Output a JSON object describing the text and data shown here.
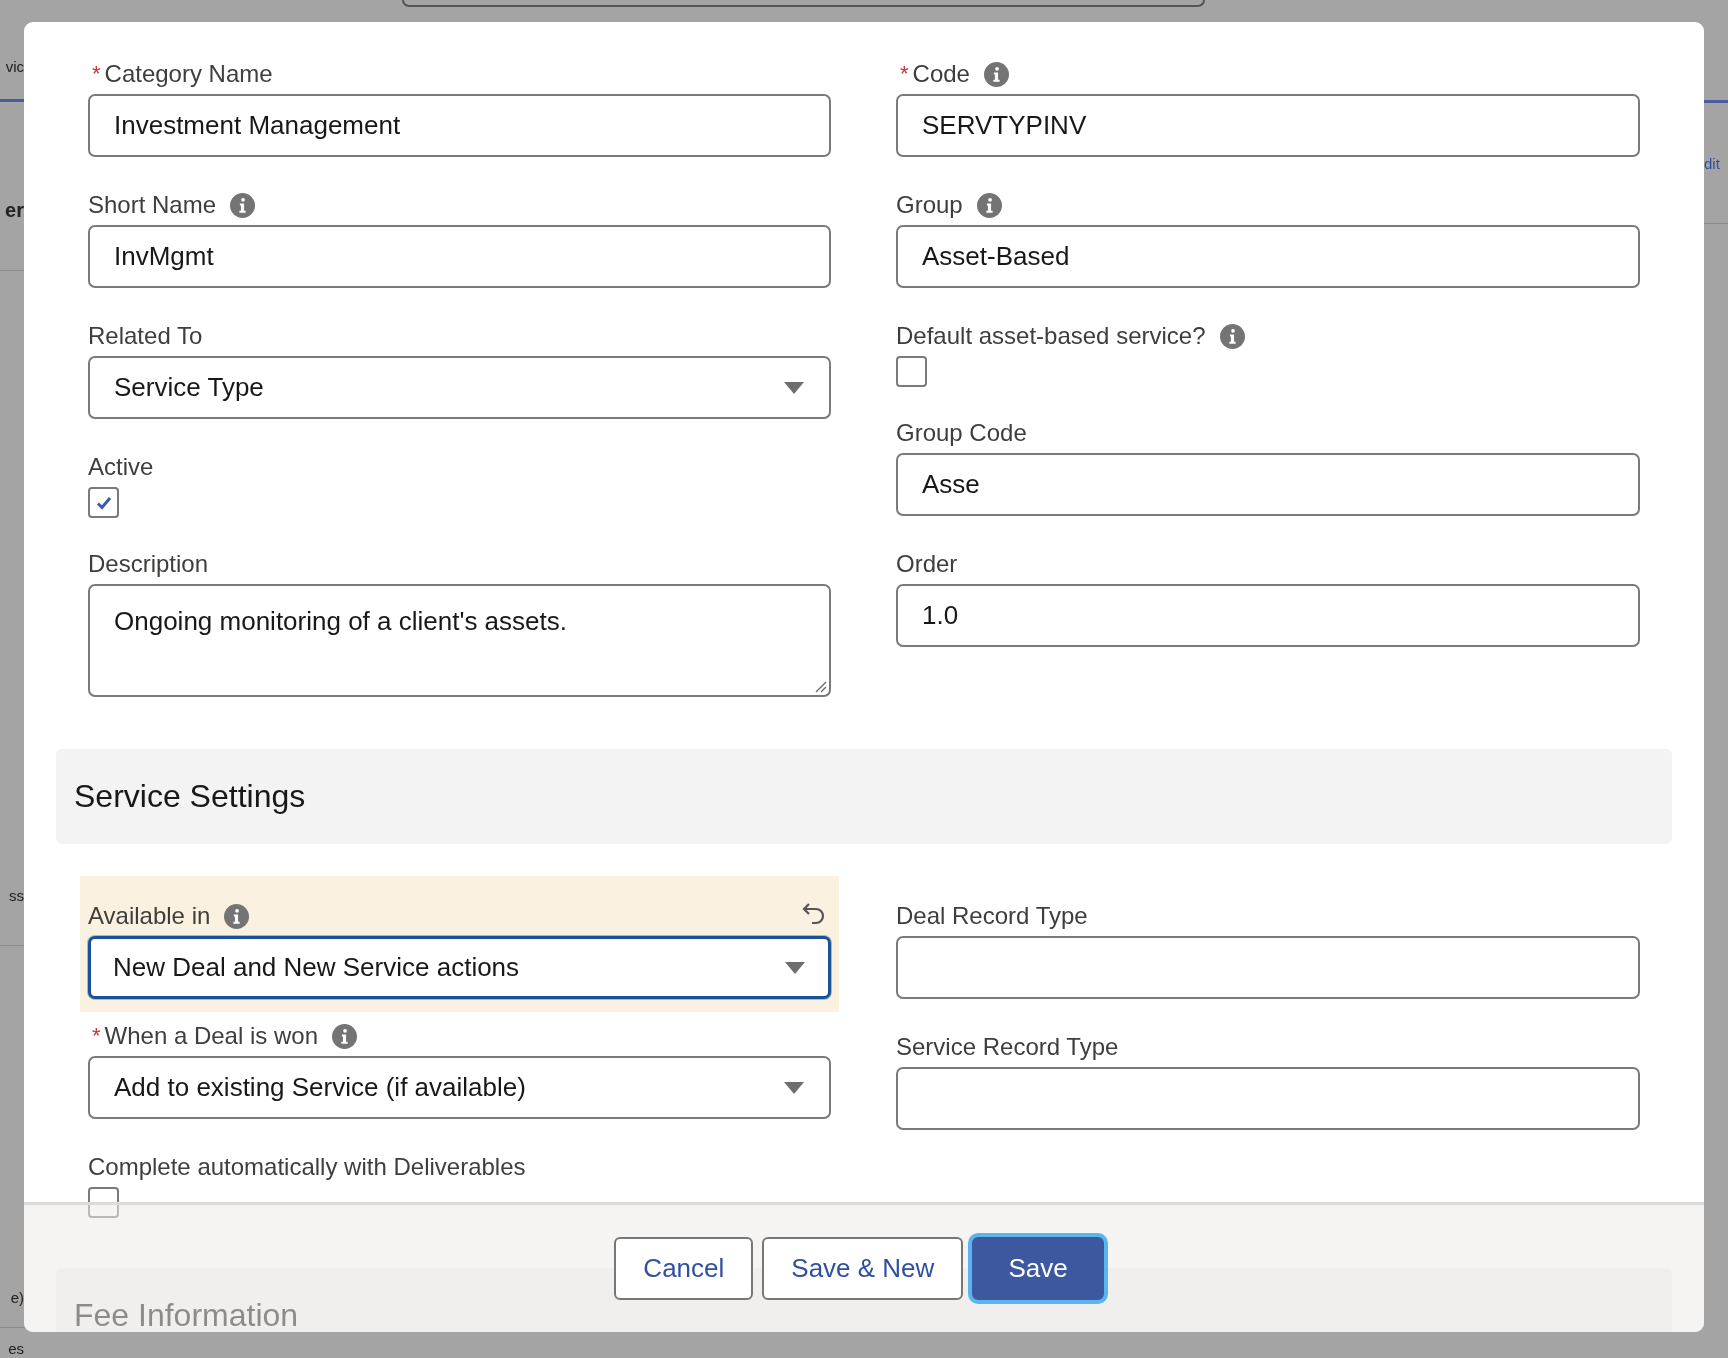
{
  "background": {
    "left_texts": [
      "vic",
      "er",
      "ss",
      "e)",
      "es"
    ],
    "right_texts": [
      "dit"
    ]
  },
  "modal": {
    "columns": {
      "left": [
        {
          "kind": "text",
          "label": "Category Name",
          "required_mark": "*",
          "info": false,
          "changed": false,
          "focused": false,
          "value": "Investment Management"
        },
        {
          "kind": "text",
          "label": "Short Name",
          "info": true,
          "changed": false,
          "focused": false,
          "value": "InvMgmt"
        },
        {
          "kind": "select",
          "label": "Related To",
          "info": false,
          "changed": false,
          "focused": false,
          "value": "Service Type"
        },
        {
          "kind": "checkbox",
          "label": "Active",
          "info": false,
          "changed": false,
          "focused": false,
          "checked": true
        },
        {
          "kind": "textarea",
          "label": "Description",
          "info": false,
          "changed": false,
          "focused": false,
          "value": "Ongoing monitoring of a client's assets."
        }
      ],
      "right": [
        {
          "kind": "text",
          "label": "Code",
          "required_mark": "*",
          "info": true,
          "changed": false,
          "focused": false,
          "value": "SERVTYPINV"
        },
        {
          "kind": "text",
          "label": "Group",
          "info": true,
          "changed": false,
          "focused": false,
          "value": "Asset-Based"
        },
        {
          "kind": "checkbox",
          "label": "Default asset-based service?",
          "info": true,
          "changed": false,
          "focused": false,
          "checked": false
        },
        {
          "kind": "text",
          "label": "Group Code",
          "info": false,
          "changed": false,
          "focused": false,
          "value": "Asse"
        },
        {
          "kind": "text",
          "label": "Order",
          "info": false,
          "changed": false,
          "focused": false,
          "value": "1.0"
        }
      ]
    },
    "sections": [
      {
        "title": "Service Settings",
        "left": [
          {
            "kind": "select",
            "label": "Available in",
            "info": true,
            "changed": true,
            "focused": true,
            "value": "New Deal and New Service actions"
          },
          {
            "kind": "select",
            "label": "When a Deal is won",
            "required_mark": "*",
            "info": true,
            "changed": false,
            "focused": false,
            "value": "Add to existing Service (if available)"
          },
          {
            "kind": "checkbox",
            "label": "Complete automatically with Deliverables",
            "info": false,
            "changed": false,
            "focused": false,
            "checked": false
          }
        ],
        "right": [
          {
            "kind": "text",
            "label": "Deal Record Type",
            "info": false,
            "changed": false,
            "focused": false
          },
          {
            "kind": "text",
            "label": "Service Record Type",
            "info": false,
            "changed": false,
            "focused": false
          }
        ]
      },
      {
        "title": "Fee Information"
      }
    ],
    "buttons": [
      {
        "label": "Cancel",
        "kind": "neutral",
        "focused": false
      },
      {
        "label": "Save & New",
        "kind": "neutral",
        "focused": false
      },
      {
        "label": "Save",
        "kind": "brand",
        "focused": true
      }
    ]
  }
}
